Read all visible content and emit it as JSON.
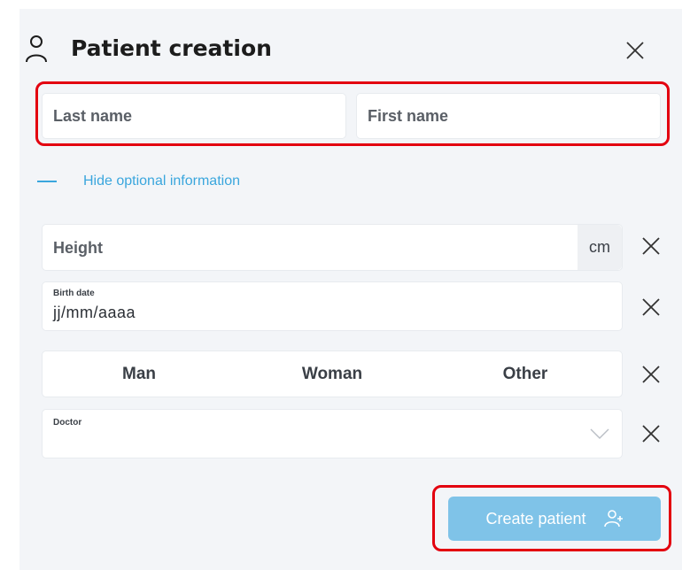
{
  "dialog": {
    "title": "Patient creation"
  },
  "name_fields": {
    "last_name_placeholder": "Last name",
    "first_name_placeholder": "First name"
  },
  "optional_toggle": {
    "label": "Hide optional information"
  },
  "height": {
    "placeholder": "Height",
    "unit": "cm"
  },
  "birth_date": {
    "label": "Birth date",
    "value": "jj/mm/aaaa"
  },
  "gender": {
    "options": [
      "Man",
      "Woman",
      "Other"
    ]
  },
  "doctor": {
    "label": "Doctor",
    "value": ""
  },
  "create_button": {
    "label": "Create patient"
  },
  "icons": {
    "user": "user-icon",
    "close": "close-icon",
    "chevron": "chevron-down-icon",
    "add_user": "add-user-icon"
  },
  "colors": {
    "accent": "#3aa6dd",
    "button": "#7fc3e8",
    "highlight": "#e3000f",
    "panel_bg": "#f3f5f8"
  }
}
